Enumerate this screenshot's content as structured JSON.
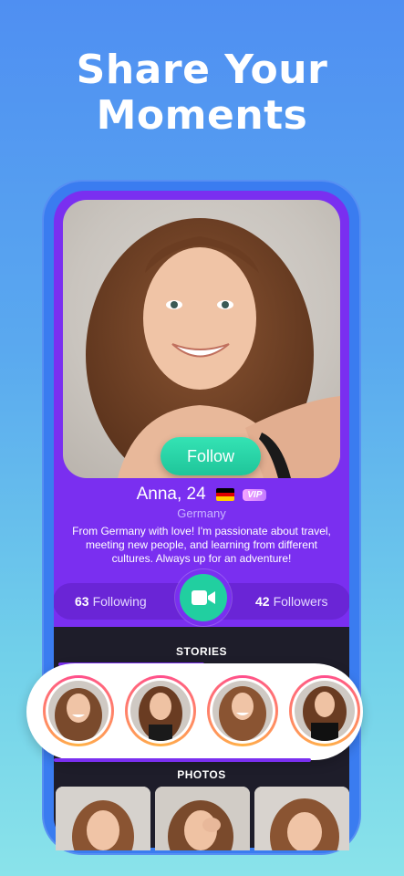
{
  "headline": {
    "line1": "Share Your",
    "line2": "Moments"
  },
  "profile": {
    "follow_label": "Follow",
    "name_age": "Anna, 24",
    "badge": "VIP",
    "flag_icon": "germany-flag-icon",
    "country": "Germany",
    "bio": "From Germany with love! I'm passionate about travel, meeting new people, and learning from different cultures. Always up for an adventure!"
  },
  "stats": {
    "following_count": "63",
    "following_label": "Following",
    "followers_count": "42",
    "followers_label": "Followers"
  },
  "sections": {
    "stories": "STORIES",
    "photos": "PHOTOS"
  },
  "colors": {
    "accent": "#7a2ff0",
    "follow": "#1fc59a",
    "dark_panel": "#1e1d2a"
  }
}
